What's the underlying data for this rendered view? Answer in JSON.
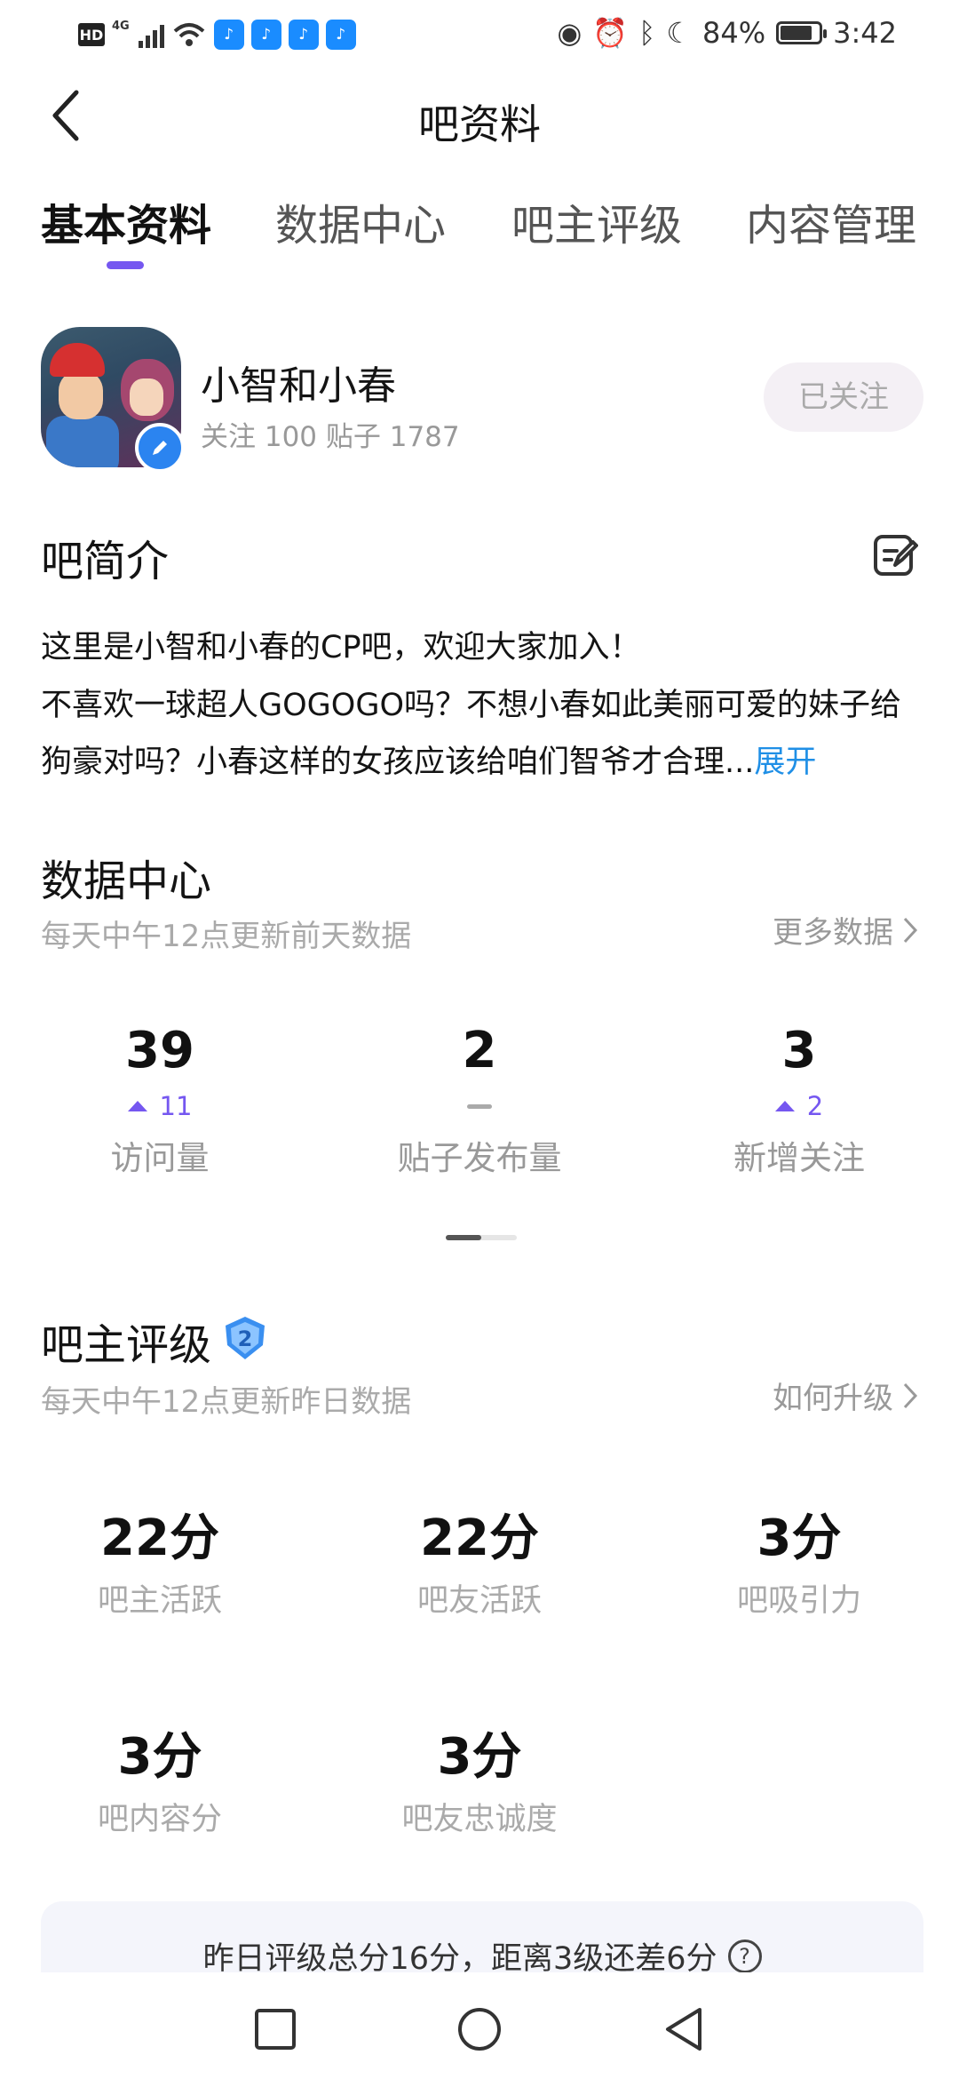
{
  "status_bar": {
    "network": "4G",
    "hd": "HD",
    "battery": "84%",
    "battery_level": 0.84,
    "time": "3:42",
    "notification_icons": [
      "chat-bell-icon",
      "chat-bell-icon",
      "chat-bell-icon",
      "chat-bell-icon"
    ]
  },
  "header": {
    "title": "吧资料"
  },
  "tabs": [
    {
      "label": "基本资料",
      "active": true
    },
    {
      "label": "数据中心",
      "active": false
    },
    {
      "label": "吧主评级",
      "active": false
    },
    {
      "label": "内容管理",
      "active": false
    }
  ],
  "forum": {
    "name": "小智和小春",
    "stats": "关注 100  贴子 1787",
    "follow_button": "已关注"
  },
  "intro": {
    "heading": "吧简介",
    "line1": "这里是小智和小春的CP吧，欢迎大家加入！",
    "line2": "不喜欢一球超人GOGOGO吗？不想小春如此美丽可爱的妹子给狗豪对吗？小春这样的女孩应该给咱们智爷才合理...",
    "expand": "展开"
  },
  "data_center": {
    "heading": "数据中心",
    "subtitle": "每天中午12点更新前天数据",
    "more_link": "更多数据",
    "stats": [
      {
        "value": "39",
        "delta": "11",
        "trend": "up",
        "label": "访问量"
      },
      {
        "value": "2",
        "delta": "",
        "trend": "flat",
        "label": "贴子发布量"
      },
      {
        "value": "3",
        "delta": "2",
        "trend": "up",
        "label": "新增关注"
      }
    ]
  },
  "rating": {
    "heading": "吧主评级",
    "level": "2",
    "subtitle": "每天中午12点更新昨日数据",
    "upgrade_link": "如何升级",
    "scores": [
      {
        "value": "22分",
        "label": "吧主活跃"
      },
      {
        "value": "22分",
        "label": "吧友活跃"
      },
      {
        "value": "3分",
        "label": "吧吸引力"
      },
      {
        "value": "3分",
        "label": "吧内容分"
      },
      {
        "value": "3分",
        "label": "吧友忠诚度"
      }
    ],
    "summary": "昨日评级总分16分，距离3级还差6分",
    "help": "?"
  },
  "colors": {
    "accent": "#7557f0",
    "link": "#1f8fe6",
    "badge": "#2b84f0"
  }
}
